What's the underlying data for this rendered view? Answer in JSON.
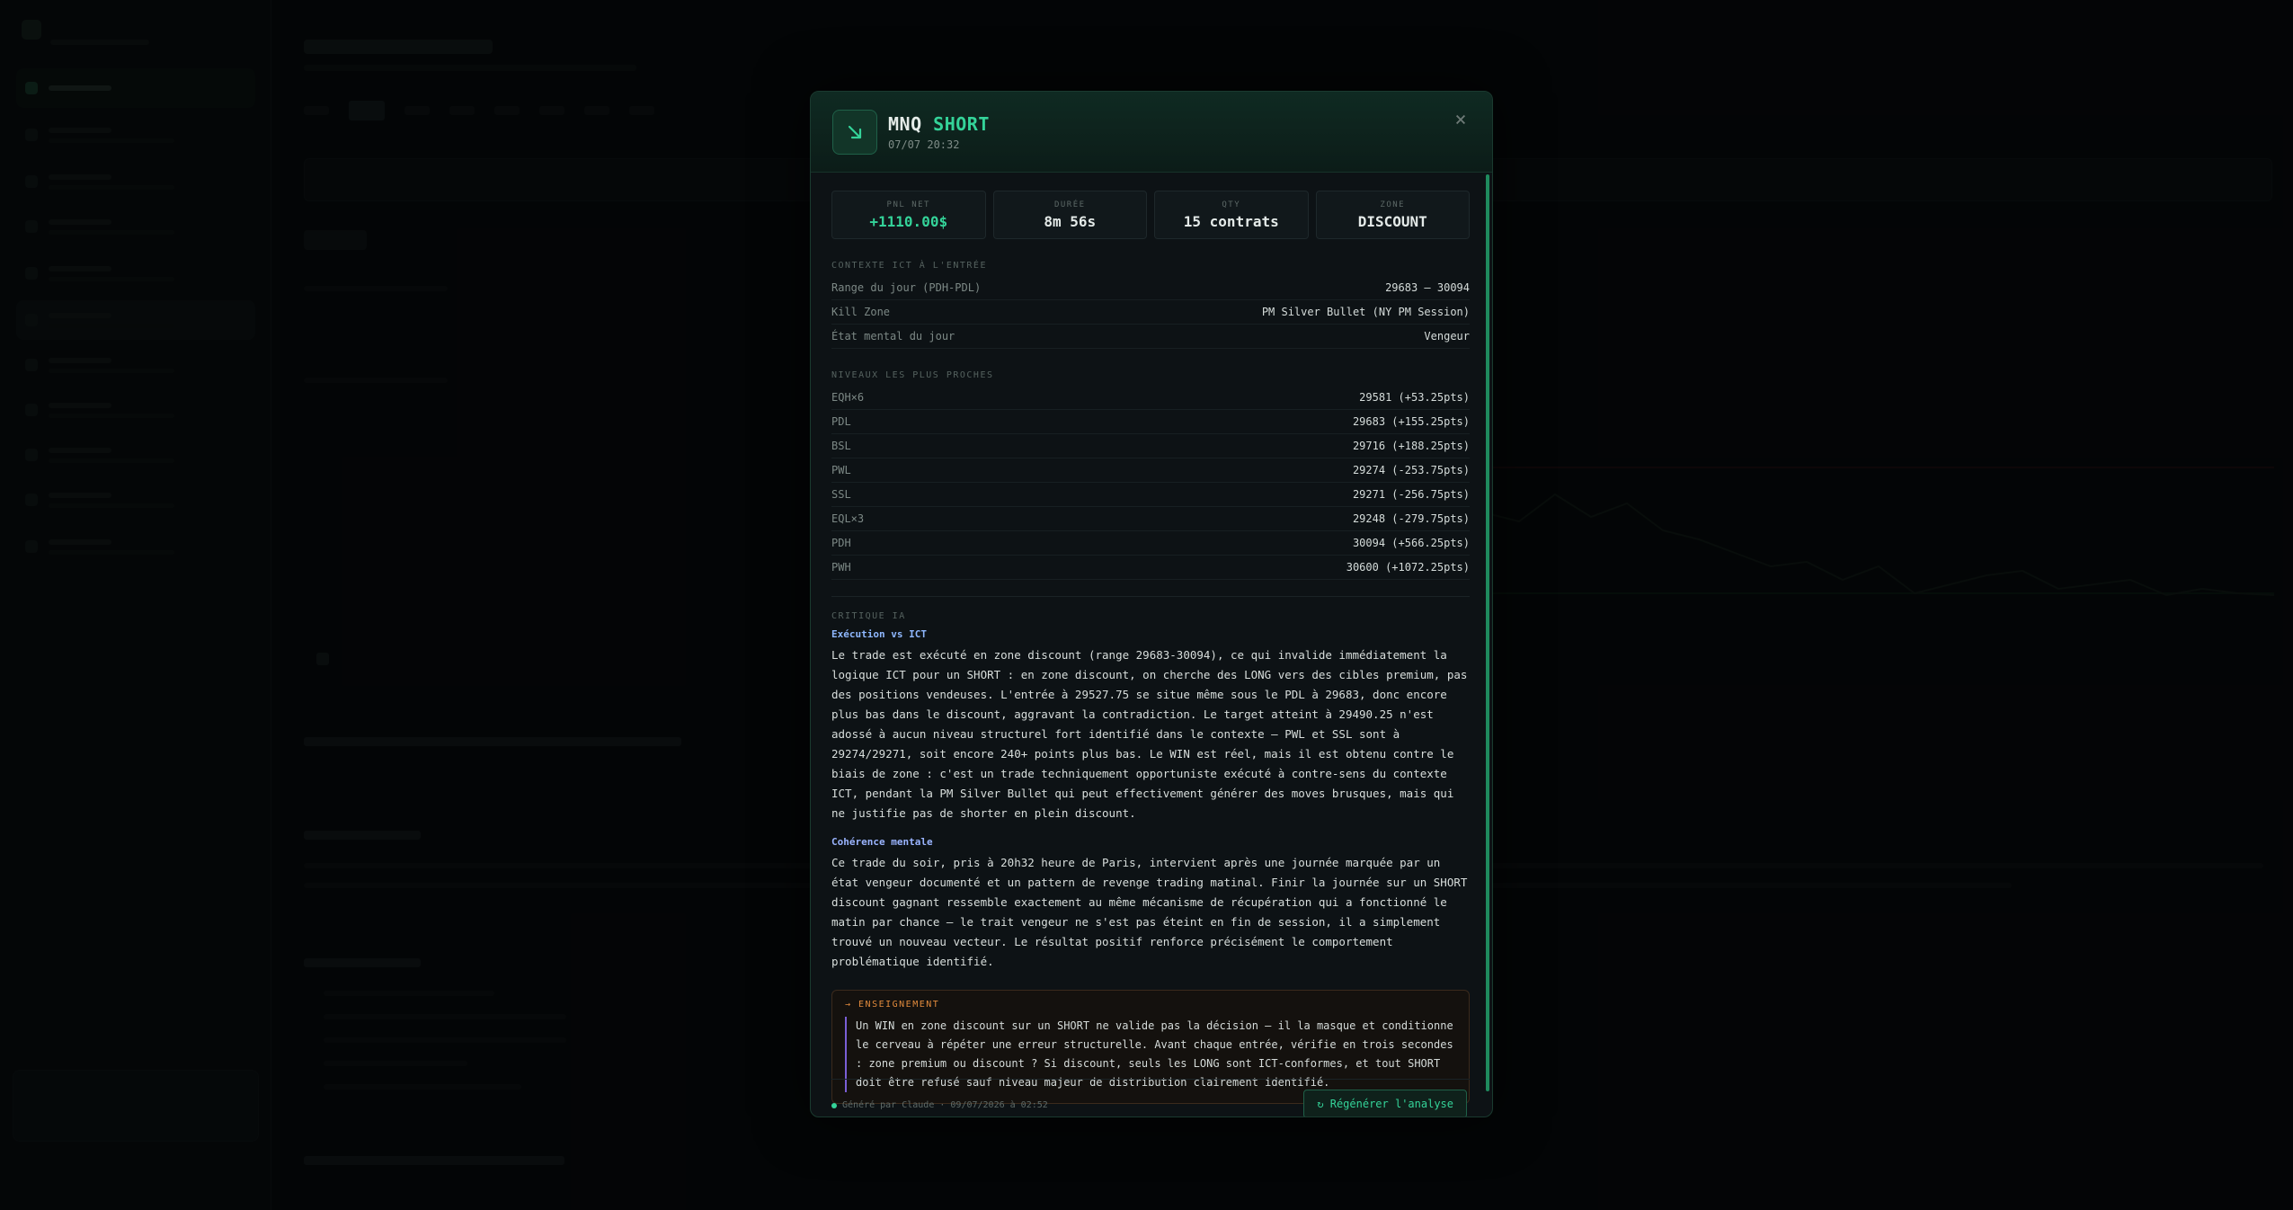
{
  "modal": {
    "symbol": "MNQ",
    "direction": "SHORT",
    "datetime": "07/07 20:32",
    "direction_icon": "arrow-down-right-icon",
    "close_glyph": "×",
    "stats": [
      {
        "label": "PNL NET",
        "value": "+1110.00$",
        "accent": "#34d399"
      },
      {
        "label": "DURÉE",
        "value": "8m 56s"
      },
      {
        "label": "QTY",
        "value": "15 contrats"
      },
      {
        "label": "ZONE",
        "value": "DISCOUNT"
      }
    ],
    "context": {
      "title": "CONTEXTE ICT À L'ENTRÉE",
      "rows": [
        {
          "key": "Range du jour (PDH-PDL)",
          "value": "29683 – 30094"
        },
        {
          "key": "Kill Zone",
          "value": "PM Silver Bullet (NY PM Session)"
        },
        {
          "key": "État mental du jour",
          "value": "Vengeur"
        }
      ]
    },
    "levels": {
      "title": "NIVEAUX LES PLUS PROCHES",
      "rows": [
        {
          "key": "EQH×6",
          "value": "29581 (+53.25pts)"
        },
        {
          "key": "PDL",
          "value": "29683 (+155.25pts)"
        },
        {
          "key": "BSL",
          "value": "29716 (+188.25pts)"
        },
        {
          "key": "PWL",
          "value": "29274 (-253.75pts)"
        },
        {
          "key": "SSL",
          "value": "29271 (-256.75pts)"
        },
        {
          "key": "EQL×3",
          "value": "29248 (-279.75pts)"
        },
        {
          "key": "PDH",
          "value": "30094 (+566.25pts)"
        },
        {
          "key": "PWH",
          "value": "30600 (+1072.25pts)"
        }
      ]
    },
    "critique": {
      "title": "CRITIQUE IA",
      "execution_title": "Exécution vs ICT",
      "execution_text": "Le trade est exécuté en zone discount (range 29683-30094), ce qui invalide immédiatement la logique ICT pour un SHORT : en zone discount, on cherche des LONG vers des cibles premium, pas des positions vendeuses. L'entrée à 29527.75 se situe même sous le PDL à 29683, donc encore plus bas dans le discount, aggravant la contradiction. Le target atteint à 29490.25 n'est adossé à aucun niveau structurel fort identifié dans le contexte — PWL et SSL sont à 29274/29271, soit encore 240+ points plus bas. Le WIN est réel, mais il est obtenu contre le biais de zone : c'est un trade techniquement opportuniste exécuté à contre-sens du contexte ICT, pendant la PM Silver Bullet qui peut effectivement générer des moves brusques, mais qui ne justifie pas de shorter en plein discount.",
      "mental_title": "Cohérence mentale",
      "mental_text": "Ce trade du soir, pris à 20h32 heure de Paris, intervient après une journée marquée par un état vengeur documenté et un pattern de revenge trading matinal. Finir la journée sur un SHORT discount gagnant ressemble exactement au même mécanisme de récupération qui a fonctionné le matin par chance — le trait vengeur ne s'est pas éteint en fin de session, il a simplement trouvé un nouveau vecteur. Le résultat positif renforce précisément le comportement problématique identifié."
    },
    "lesson": {
      "label": "→ ENSEIGNEMENT",
      "text": "Un WIN en zone discount sur un SHORT ne valide pas la décision — il la masque et conditionne le cerveau à répéter une erreur structurelle. Avant chaque entrée, vérifie en trois secondes : zone premium ou discount ? Si discount, seuls les LONG sont ICT-conformes, et tout SHORT doit être refusé sauf niveau majeur de distribution clairement identifié."
    },
    "footer": {
      "generated": "Généré par Claude · 09/07/2026 à 02:52",
      "regenerate_label": "↻ Régénérer l'analyse"
    }
  },
  "colors": {
    "accent": "#34d399",
    "lesson_border": "#3b2a1c",
    "lesson_label": "#e08a3c",
    "subhead": "#8fb8ff"
  }
}
